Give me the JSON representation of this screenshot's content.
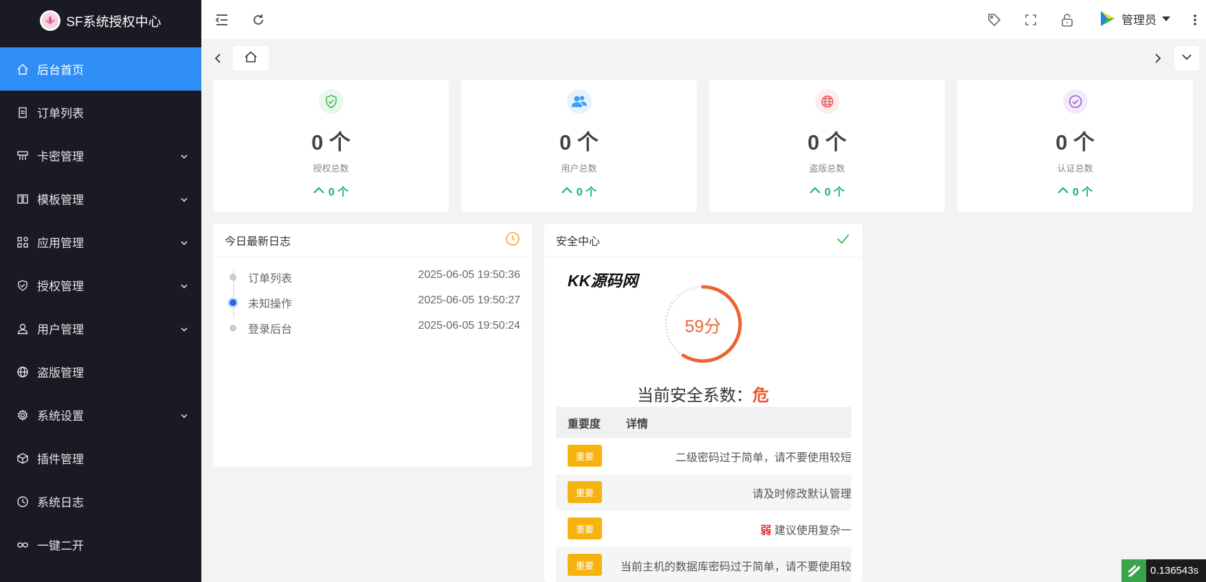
{
  "app": {
    "title": "SF系统授权中心"
  },
  "sidebar": {
    "items": [
      {
        "label": "后台首页",
        "icon": "home-icon",
        "active": true,
        "expandable": false
      },
      {
        "label": "订单列表",
        "icon": "document-icon",
        "active": false,
        "expandable": false
      },
      {
        "label": "卡密管理",
        "icon": "card-icon",
        "active": false,
        "expandable": true
      },
      {
        "label": "模板管理",
        "icon": "template-icon",
        "active": false,
        "expandable": true
      },
      {
        "label": "应用管理",
        "icon": "apps-icon",
        "active": false,
        "expandable": true
      },
      {
        "label": "授权管理",
        "icon": "shield-icon",
        "active": false,
        "expandable": true
      },
      {
        "label": "用户管理",
        "icon": "user-icon",
        "active": false,
        "expandable": true
      },
      {
        "label": "盗版管理",
        "icon": "globe-icon",
        "active": false,
        "expandable": false
      },
      {
        "label": "系统设置",
        "icon": "gear-icon",
        "active": false,
        "expandable": true
      },
      {
        "label": "插件管理",
        "icon": "cube-icon",
        "active": false,
        "expandable": false
      },
      {
        "label": "系统日志",
        "icon": "clock-icon",
        "active": false,
        "expandable": false
      },
      {
        "label": "一键二开",
        "icon": "infinity-icon",
        "active": false,
        "expandable": false
      }
    ]
  },
  "header": {
    "user_name": "管理员"
  },
  "stats": [
    {
      "value": "0 个",
      "label": "授权总数",
      "trend": "0 个",
      "icon": "shield-check-icon",
      "color": "#3fb950",
      "bg": "#eaf7ec"
    },
    {
      "value": "0 个",
      "label": "用户总数",
      "trend": "0 个",
      "icon": "users-icon",
      "color": "#3a9ef5",
      "bg": "#e6f2fe"
    },
    {
      "value": "0 个",
      "label": "盗版总数",
      "trend": "0 个",
      "icon": "globe-icon",
      "color": "#ef5a5a",
      "bg": "#fdeeee"
    },
    {
      "value": "0 个",
      "label": "认证总数",
      "trend": "0 个",
      "icon": "check-circle-icon",
      "color": "#9b59d0",
      "bg": "#f3ebfa"
    }
  ],
  "log_panel": {
    "title": "今日最新日志",
    "rows": [
      {
        "name": "订单列表",
        "time": "2025-06-05 19:50:36",
        "active": false
      },
      {
        "name": "未知操作",
        "time": "2025-06-05 19:50:27",
        "active": true
      },
      {
        "name": "登录后台",
        "time": "2025-06-05 19:50:24",
        "active": false
      }
    ]
  },
  "security_panel": {
    "title": "安全中心",
    "watermark": "KK源码网",
    "score": 59,
    "score_text": "59分",
    "score_max": 100,
    "safety_label": "当前安全系数：",
    "safety_level": "危",
    "table": {
      "col_importance": "重要度",
      "col_detail": "详情",
      "rows": [
        {
          "badge": "重要",
          "prefix": "",
          "detail": "二级密码过于简单，请不要使用较短"
        },
        {
          "badge": "重要",
          "prefix": "",
          "detail": "请及时修改默认管理"
        },
        {
          "badge": "重要",
          "prefix": "弱",
          "detail": "建议使用复杂一"
        },
        {
          "badge": "重要",
          "prefix": "",
          "detail": "当前主机的数据库密码过于简单，请不要使用较"
        }
      ]
    }
  },
  "timer": {
    "value": "0.136543s"
  }
}
